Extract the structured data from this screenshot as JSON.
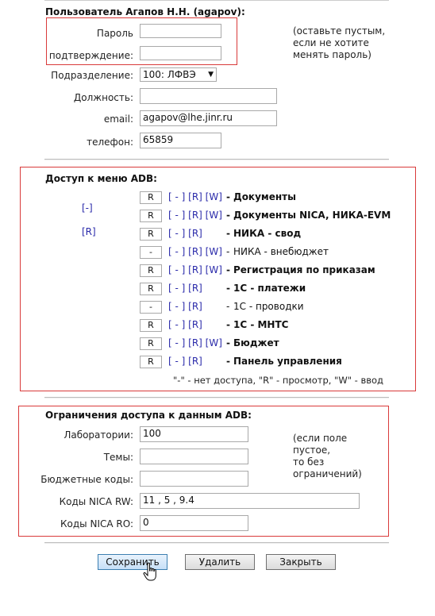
{
  "user": {
    "heading": "Пользователь Агапов Н.Н. (agapov):",
    "password_label": "Пароль",
    "password_value": "",
    "confirm_label": "подтверждение:",
    "confirm_value": "",
    "password_note": [
      "(оставьте пустым,",
      "если не хотите",
      "менять пароль)"
    ],
    "division_label": "Подразделение:",
    "division_value": "100: ЛФВЭ",
    "position_label": "Должность:",
    "position_value": "",
    "email_label": "email:",
    "email_value": "agapov@lhe.jinr.ru",
    "phone_label": "телефон:",
    "phone_value": "65859"
  },
  "access": {
    "heading": "Доступ к меню ADB:",
    "toggle_all_none": "[-]",
    "toggle_all_read": "[R]",
    "items": [
      {
        "level": "R",
        "links": "[ - ] [R] [W]",
        "sep": "-",
        "name": "Документы",
        "bold": true
      },
      {
        "level": "R",
        "links": "[ - ] [R] [W]",
        "sep": "-",
        "name": "Документы NICA, НИКА-EVM",
        "bold": true
      },
      {
        "level": "R",
        "links": "[ - ] [R]",
        "sep": "-",
        "name": "НИКА - свод",
        "bold": true
      },
      {
        "level": "-",
        "links": "[ - ] [R] [W]",
        "sep": "-",
        "name": "НИКА - внебюджет",
        "bold": false
      },
      {
        "level": "R",
        "links": "[ - ] [R] [W]",
        "sep": "-",
        "name": "Регистрация по приказам",
        "bold": true
      },
      {
        "level": "R",
        "links": "[ - ] [R]",
        "sep": "-",
        "name": "1С - платежи",
        "bold": true
      },
      {
        "level": "-",
        "links": "[ - ] [R]",
        "sep": "-",
        "name": "1С - проводки",
        "bold": false
      },
      {
        "level": "R",
        "links": "[ - ] [R]",
        "sep": "-",
        "name": "1С - МНТС",
        "bold": true
      },
      {
        "level": "R",
        "links": "[ - ] [R] [W]",
        "sep": "-",
        "name": "Бюджет",
        "bold": true
      },
      {
        "level": "R",
        "links": "[ - ] [R]",
        "sep": "-",
        "name": "Панель управления",
        "bold": true
      }
    ],
    "legend": "\"-\" - нет доступа, \"R\" - просмотр, \"W\" - ввод"
  },
  "restrictions": {
    "heading": "Ограничения доступа к данным ADB:",
    "labs_label": "Лаборатории:",
    "labs_value": "100",
    "topics_label": "Темы:",
    "topics_value": "",
    "budget_label": "Бюджетные коды:",
    "budget_value": "",
    "nica_rw_label": "Коды NICA RW:",
    "nica_rw_value": "11 , 5 , 9.4",
    "nica_ro_label": "Коды NICA RO:",
    "nica_ro_value": "0",
    "note": [
      "(если поле",
      "пустое,",
      "то без",
      "ограничений)"
    ]
  },
  "buttons": {
    "save": "Сохранить",
    "delete": "Удалить",
    "close": "Закрыть"
  },
  "colors": {
    "highlight_border": "#d93a3a",
    "link": "#2a2aaa"
  }
}
